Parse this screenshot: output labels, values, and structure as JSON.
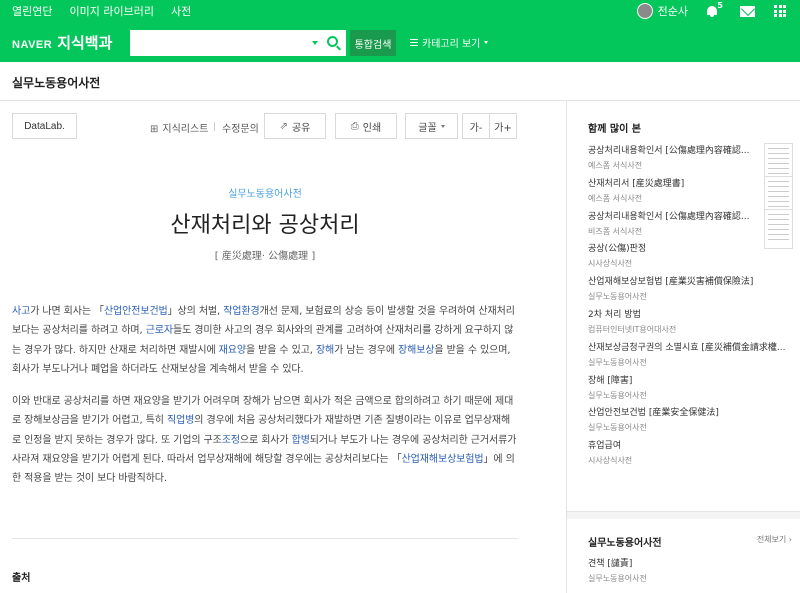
{
  "topbar": {
    "links": [
      "열린연단",
      "이미지 라이브러리",
      "사전"
    ],
    "username": "전순사",
    "notification_count": "5",
    "icons": [
      "avatar",
      "bell-icon",
      "mail-icon",
      "apps-grid-icon"
    ]
  },
  "header": {
    "brand": "NAVER",
    "service": "지식백과",
    "search_value": "",
    "search_button": "통합검색",
    "category_button": "카테고리 보기",
    "accent_color": "#03c75a"
  },
  "dict_name": "실무노동용어사전",
  "toolbar": {
    "datalab": "DataLab.",
    "knowledge_list": "지식리스트",
    "edit_request": "수정문의",
    "share": "공유",
    "print": "인쇄",
    "font": "글꼴",
    "font_smaller": "가-",
    "font_larger": "가+"
  },
  "entry": {
    "category": "실무노동용어사전",
    "title": "산재처리와 공상처리",
    "hanja": "[ 産災處理· 公傷處理 ]",
    "p1": [
      {
        "t": "사고",
        "l": true
      },
      {
        "t": "가 나면 회사는 「"
      },
      {
        "t": "산업안전보건법",
        "l": true
      },
      {
        "t": "」상의 처벌, "
      },
      {
        "t": "작업환경",
        "l": true
      },
      {
        "t": "개선 문제, 보험료의 상승 등이 발생할 것을 우려하여 산재처리보다는 공상처리를 하려고 하며, "
      },
      {
        "t": "근로자",
        "l": true
      },
      {
        "t": "들도 경미한 사고의 경우 회사와의 관계를 고려하여 산재처리를 강하게 요구하지 않는 경우가 많다. 하지만 산재로 처리하면 재발시에 "
      },
      {
        "t": "재요양",
        "l": true
      },
      {
        "t": "을 받을 수 있고, "
      },
      {
        "t": "장해",
        "l": true
      },
      {
        "t": "가 남는 경우에 "
      },
      {
        "t": "장해보상",
        "l": true
      },
      {
        "t": "을 받을 수 있으며, 회사가 부도나거나 폐업을 하더라도 산재보상을 계속해서 받을 수 있다."
      }
    ],
    "p2": [
      {
        "t": "이와 반대로 공상처리를 하면 재요양을 받기가 어려우며 장해가 남으면 회사가 적은 금액으로 합의하려고 하기 때문에 제대로 장해보상금을 받기가 어렵고, 특히 "
      },
      {
        "t": "직업병",
        "l": true
      },
      {
        "t": "의 경우에 처음 공상처리했다가 재발하면 기존 질병이라는 이유로 업무상재해로 인정을 받지 못하는 경우가 많다. 또 기업의 구조"
      },
      {
        "t": "조정",
        "l": true
      },
      {
        "t": "으로 회사가 "
      },
      {
        "t": "합병",
        "l": true
      },
      {
        "t": "되거나 부도가 나는 경우에 공상처리한 근거서류가 사라져 재요양을 받기가 어렵게 된다. 따라서 업무상재해에 해당할 경우에는 공상처리보다는 「"
      },
      {
        "t": "산업재해보상보험법",
        "l": true
      },
      {
        "t": "」에 의한 적용을 받는 것이 보다 바람직하다."
      }
    ],
    "source_label": "출처"
  },
  "sidebar": {
    "title": "함께 많이 본",
    "items": [
      {
        "title": "공상처리내용확인서 [公傷處理內容確認...",
        "source": "예스폼 서식사전",
        "thumb": true
      },
      {
        "title": "산재처리서 [産災處理書]",
        "source": "예스폼 서식사전",
        "thumb": true
      },
      {
        "title": "공상처리내용확인서 [公傷處理內容確認...",
        "source": "비즈폼 서식사전",
        "thumb": true
      },
      {
        "title": "공상(公傷)판정",
        "source": "시사상식사전",
        "thumb": false
      },
      {
        "title": "산업재해보상보험법 [産業災害補償保險法]",
        "source": "실무노동용어사전",
        "thumb": false
      },
      {
        "title": "2차 처리 방법",
        "source": "컴퓨터인터넷IT용어대사전",
        "thumb": false
      },
      {
        "title": "산재보상금청구권의 소멸시효 [産災補償金請求權...",
        "source": "실무노동용어사전",
        "thumb": false
      },
      {
        "title": "장해 [障害]",
        "source": "실무노동용어사전",
        "thumb": false
      },
      {
        "title": "산업안전보건법 [産業安全保健法]",
        "source": "실무노동용어사전",
        "thumb": false
      },
      {
        "title": "휴업급여",
        "source": "시사상식사전",
        "thumb": false
      }
    ],
    "section2_title": "실무노동용어사전",
    "section2_more": "전체보기 ›",
    "section2_items": [
      {
        "title": "견책 [譴責]",
        "source": "실무노동용어사전"
      }
    ]
  }
}
